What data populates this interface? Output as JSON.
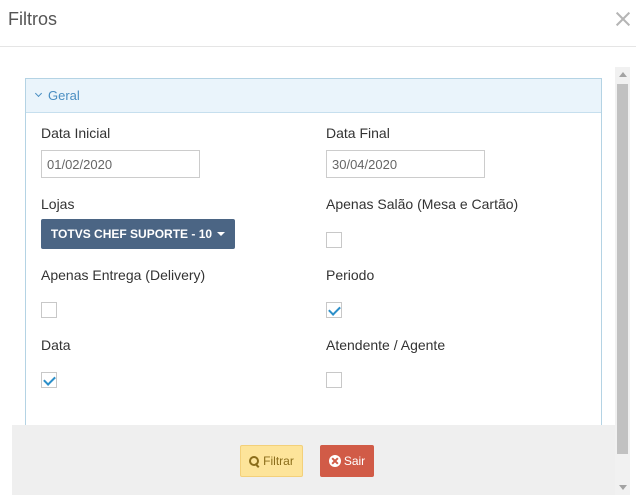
{
  "modal": {
    "title": "Filtros"
  },
  "panel": {
    "heading": "Geral"
  },
  "fields": {
    "data_inicial": {
      "label": "Data Inicial",
      "value": "01/02/2020"
    },
    "data_final": {
      "label": "Data Final",
      "value": "30/04/2020"
    },
    "lojas": {
      "label": "Lojas",
      "selected": "TOTVS CHEF SUPORTE - 10"
    },
    "apenas_salao": {
      "label": "Apenas Salão (Mesa e Cartão)",
      "checked": false
    },
    "apenas_entrega": {
      "label": "Apenas Entrega (Delivery)",
      "checked": false
    },
    "periodo": {
      "label": "Periodo",
      "checked": true
    },
    "data": {
      "label": "Data",
      "checked": true
    },
    "atendente": {
      "label": "Atendente / Agente",
      "checked": false
    }
  },
  "footer": {
    "filter_label": "Filtrar",
    "exit_label": "Sair"
  },
  "colors": {
    "panel_header_bg": "#eaf4fb",
    "accent_blue": "#4a8ec2",
    "dropdown_bg": "#4b6584",
    "filter_btn_bg": "#fde49a",
    "exit_btn_bg": "#d15b47",
    "checkmark": "#2c8fc9"
  }
}
